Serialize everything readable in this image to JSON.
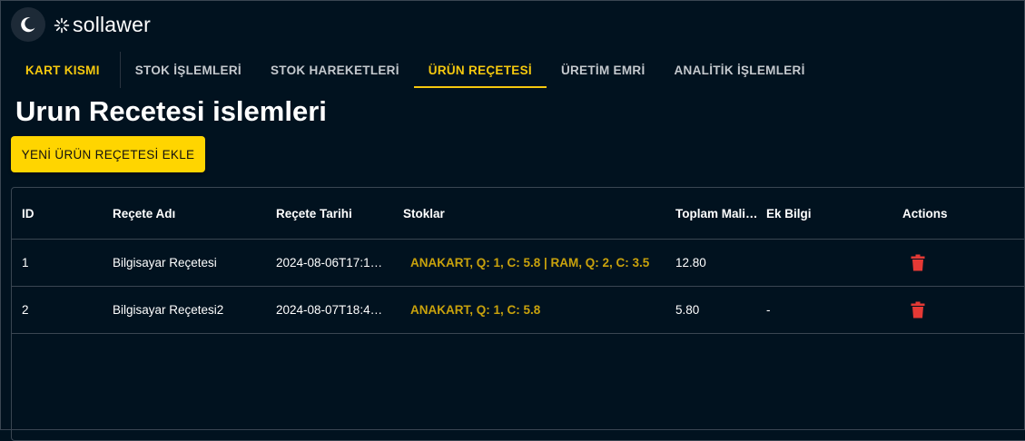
{
  "brand": {
    "name": "sollawer"
  },
  "nav": {
    "tabs": [
      {
        "label": "KART KISMI"
      },
      {
        "label": "STOK İŞLEMLERİ"
      },
      {
        "label": "STOK HAREKETLERİ"
      },
      {
        "label": "ÜRÜN REÇETESİ"
      },
      {
        "label": "ÜRETİM EMRİ"
      },
      {
        "label": "ANALİTİK İŞLEMLERİ"
      }
    ],
    "active_tab": "ÜRÜN REÇETESİ"
  },
  "page": {
    "title": "Urun Recetesi islemleri",
    "add_button_label": "YENİ ÜRÜN REÇETESİ EKLE"
  },
  "table": {
    "columns": [
      "ID",
      "Reçete Adı",
      "Reçete Tarihi",
      "Stoklar",
      "Toplam Mali…",
      "Ek Bilgi",
      "Actions"
    ],
    "rows": [
      {
        "id": "1",
        "name": "Bilgisayar Reçetesi",
        "date": "2024-08-06T17:1…",
        "stocks": "ANAKART, Q: 1, C: 5.8 | RAM, Q: 2, C: 3.5",
        "cost": "12.80",
        "info": ""
      },
      {
        "id": "2",
        "name": "Bilgisayar Reçetesi2",
        "date": "2024-08-07T18:4…",
        "stocks": "ANAKART, Q: 1, C: 5.8",
        "cost": "5.80",
        "info": "-"
      }
    ]
  },
  "colors": {
    "background": "#01121f",
    "accent": "#f6c90e",
    "button": "#ffd500",
    "stock_text": "#c9a20c",
    "delete": "#e53935"
  },
  "icons": {
    "theme_toggle": "moon-icon",
    "brand_logo": "sunburst-logo-icon",
    "row_action": "delete-icon"
  }
}
